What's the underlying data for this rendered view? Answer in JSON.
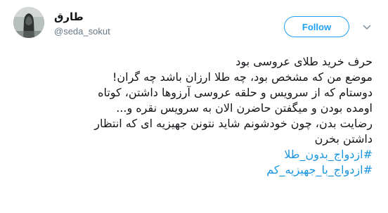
{
  "user": {
    "display_name": "طارق",
    "handle": "@seda_sokut"
  },
  "follow_button": {
    "label": "Follow"
  },
  "tweet": {
    "lines": [
      "حرف خرید طلای عروسی بود",
      "موضع من که مشخص بود، چه طلا ارزان باشد چه گران!",
      "دوستام که از سرویس و حلقه عروسی آرزوها داشتن، کوتاه",
      "اومده بودن و میگفتن حاضرن الان به سرویس نقره و...",
      "رضایت بدن، چون خودشونم شاید نتونن جهیزیه ای که انتظار",
      "داشتن بخرن"
    ],
    "hashtags": [
      "#ازدواج_بدون_طلا",
      "#ازدواج_با_جهیزیه_کم"
    ]
  },
  "colors": {
    "accent": "#1da1f2",
    "link": "#1b95e0",
    "text": "#14171a",
    "muted": "#657786"
  },
  "icons": {
    "more_menu": "chevron-down-icon"
  }
}
